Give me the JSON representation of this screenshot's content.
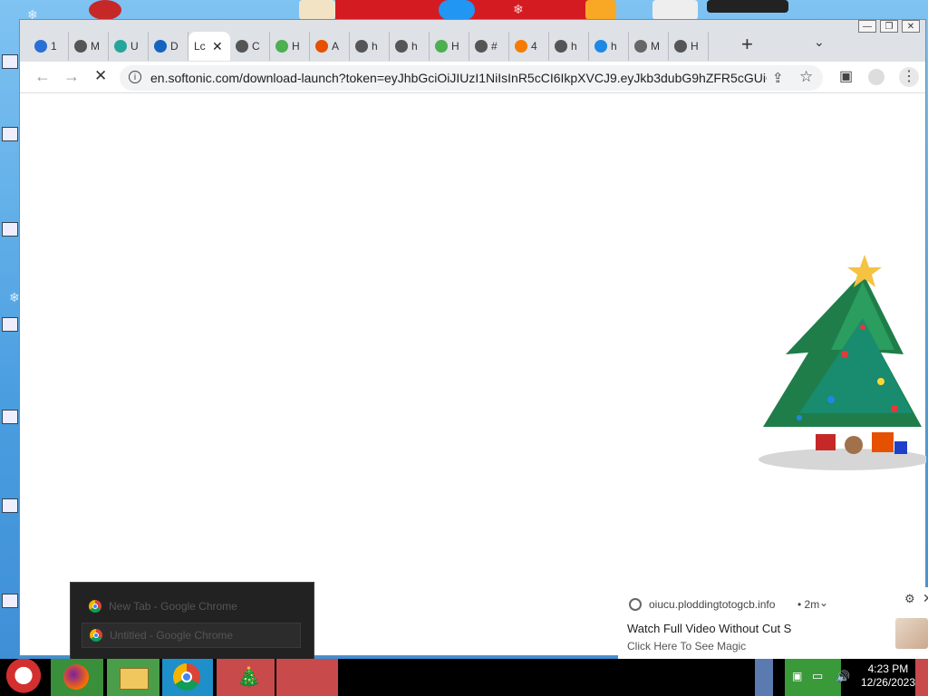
{
  "browser": {
    "tabs": [
      {
        "label": "1",
        "favicon": "globe-icon",
        "color": "#2a6fd6"
      },
      {
        "label": "M",
        "favicon": "globe-icon",
        "color": "#555555"
      },
      {
        "label": "U",
        "favicon": "puzzle-icon",
        "color": "#26a69a"
      },
      {
        "label": "D",
        "favicon": "dot-icon",
        "color": "#1565c0"
      },
      {
        "label": "Lc",
        "favicon": "none",
        "color": "#ffffff",
        "active": true
      },
      {
        "label": "C",
        "favicon": "globe-icon",
        "color": "#555555"
      },
      {
        "label": "H",
        "favicon": "leaf-icon",
        "color": "#4caf50"
      },
      {
        "label": "A",
        "favicon": "rainbow-icon",
        "color": "#e65100"
      },
      {
        "label": "h",
        "favicon": "globe-icon",
        "color": "#555555"
      },
      {
        "label": "h",
        "favicon": "globe-icon",
        "color": "#555555"
      },
      {
        "label": "H",
        "favicon": "leaf-icon",
        "color": "#4caf50"
      },
      {
        "label": "#",
        "favicon": "globe-icon",
        "color": "#555555"
      },
      {
        "label": "4",
        "favicon": "blogger-icon",
        "color": "#f57c00"
      },
      {
        "label": "h",
        "favicon": "camera-icon",
        "color": "#555555"
      },
      {
        "label": "h",
        "favicon": "wave-icon",
        "color": "#1e88e5"
      },
      {
        "label": "M",
        "favicon": "chrome-icon",
        "color": "#666666"
      },
      {
        "label": "H",
        "favicon": "globe-icon",
        "color": "#555555"
      }
    ],
    "url": "en.softonic.com/download-launch?token=eyJhbGciOiJIUzI1NiIsInR5cCI6IkpXVCJ9.eyJkb3dubG9hZFR5cGUiO..."
  },
  "notification": {
    "site": "oiucu.ploddingtotogcb.info",
    "age": "• 2m",
    "title": "Watch Full Video Without Cut S",
    "body": "Click Here To See Magic"
  },
  "taskbar_popup": {
    "items": [
      "New Tab - Google Chrome",
      "Untitled - Google Chrome"
    ]
  },
  "clock": {
    "time": "4:23 PM",
    "date": "12/26/2023"
  }
}
